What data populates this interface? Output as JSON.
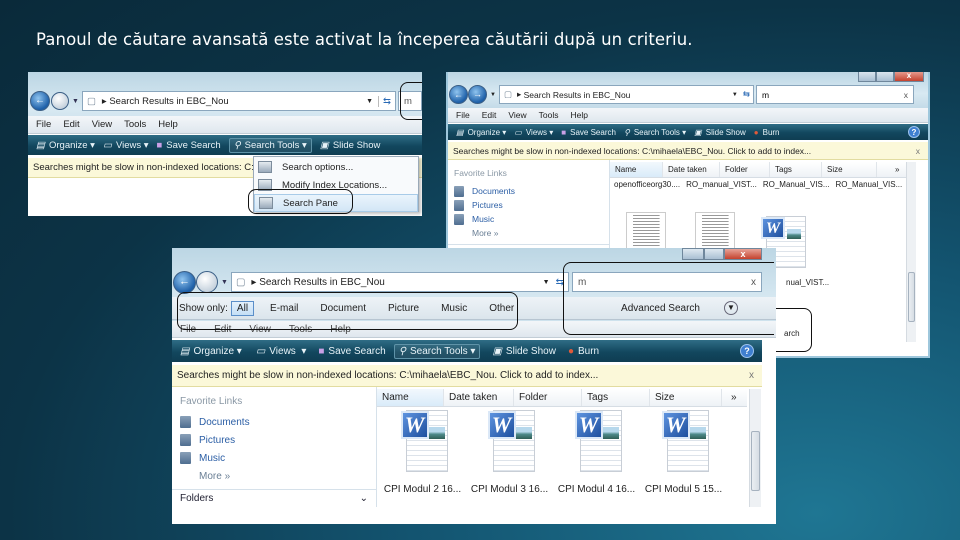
{
  "slide_title": "Panoul de căutare avansată este activat la începerea căutării după un criteriu.",
  "explorer": {
    "address": "Search Results in EBC_Nou",
    "search_query": "m",
    "menu": [
      "File",
      "Edit",
      "View",
      "Tools",
      "Help"
    ],
    "toolbar": {
      "organize": "Organize",
      "views": "Views",
      "save_search": "Save Search",
      "search_tools": "Search Tools",
      "slide_show": "Slide Show",
      "burn": "Burn",
      "help": "?"
    },
    "info_bar": "Searches might be slow in non-indexed locations: C:\\mihaela\\EBC_Nou. Click to add to index...",
    "info_bar_short": "Searches might be slow in non-indexed locations: C:\\",
    "favorite_links": "Favorite Links",
    "links": [
      "Documents",
      "Pictures",
      "Music"
    ],
    "more": "More",
    "folders": "Folders",
    "columns": [
      "Name",
      "Date taken",
      "Folder",
      "Tags",
      "Size"
    ],
    "more_cols": "»"
  },
  "window1": {
    "dropdown": [
      "Search options...",
      "Modify Index Locations...",
      "Search Pane"
    ]
  },
  "window2": {
    "files": [
      "openofficeorg30....",
      "RO_manual_VIST...",
      "RO_Manual_VIS...",
      "RO_Manual_VIS..."
    ],
    "partial_file": "nual_VIST...",
    "partial_button": "arch"
  },
  "window3": {
    "show_only_label": "Show only:",
    "filters": [
      "All",
      "E-mail",
      "Document",
      "Picture",
      "Music",
      "Other"
    ],
    "active_filter": "All",
    "advanced_search": "Advanced Search",
    "files": [
      "CPI Modul 2 16...",
      "CPI Modul 3 16...",
      "CPI Modul 4 16...",
      "CPI Modul 5 15..."
    ]
  },
  "colors": {
    "toolbar": "#12475e",
    "info_bar": "#fbf8d9",
    "link": "#2b5ea5",
    "annotation": "#111111"
  }
}
